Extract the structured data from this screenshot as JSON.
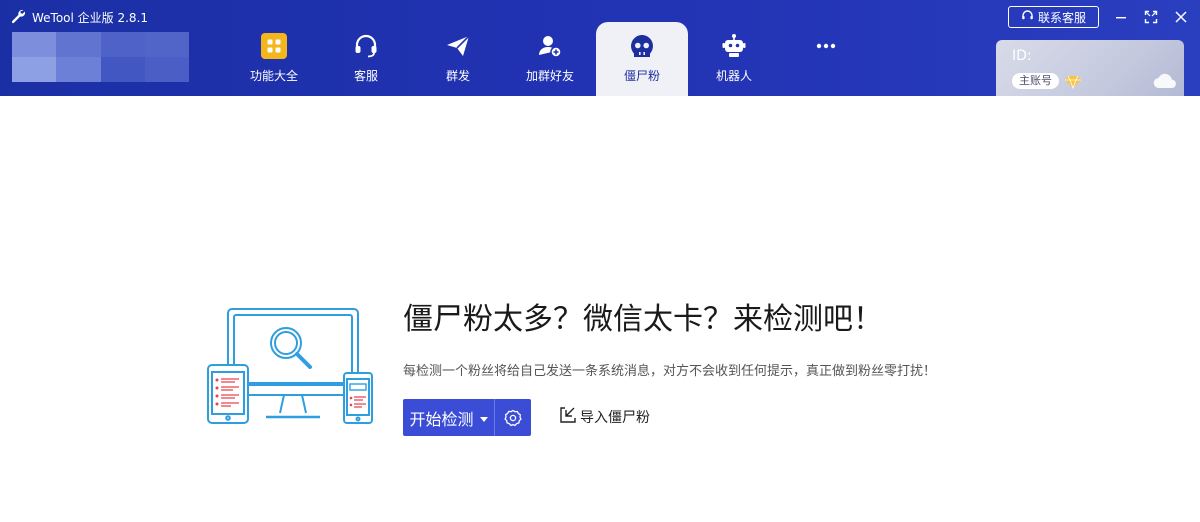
{
  "app": {
    "title": "WeTool 企业版 2.8.1"
  },
  "nav": {
    "items": [
      {
        "label": "功能大全",
        "icon": "grid-icon"
      },
      {
        "label": "客服",
        "icon": "headset-icon"
      },
      {
        "label": "群发",
        "icon": "paper-plane-icon"
      },
      {
        "label": "加群好友",
        "icon": "add-user-icon"
      },
      {
        "label": "僵尸粉",
        "icon": "skull-icon",
        "active": true
      },
      {
        "label": "机器人",
        "icon": "robot-icon"
      },
      {
        "label": "",
        "icon": "more-icon"
      }
    ]
  },
  "header": {
    "contact_label": "联系客服"
  },
  "account": {
    "id_label": "ID:",
    "badge": "主账号"
  },
  "main": {
    "headline": "僵尸粉太多？微信太卡？来检测吧！",
    "description": "每检测一个粉丝将给自己发送一条系统消息，对方不会收到任何提示，真正做到粉丝零打扰！",
    "start_label": "开始检测",
    "import_label": "导入僵尸粉"
  },
  "colors": {
    "header_bg": "#2233b4",
    "accent": "#3b4dd6",
    "active_tab_bg": "#f0f1f6",
    "illustration": "#2f9ee0",
    "alert_red": "#e8434a"
  }
}
